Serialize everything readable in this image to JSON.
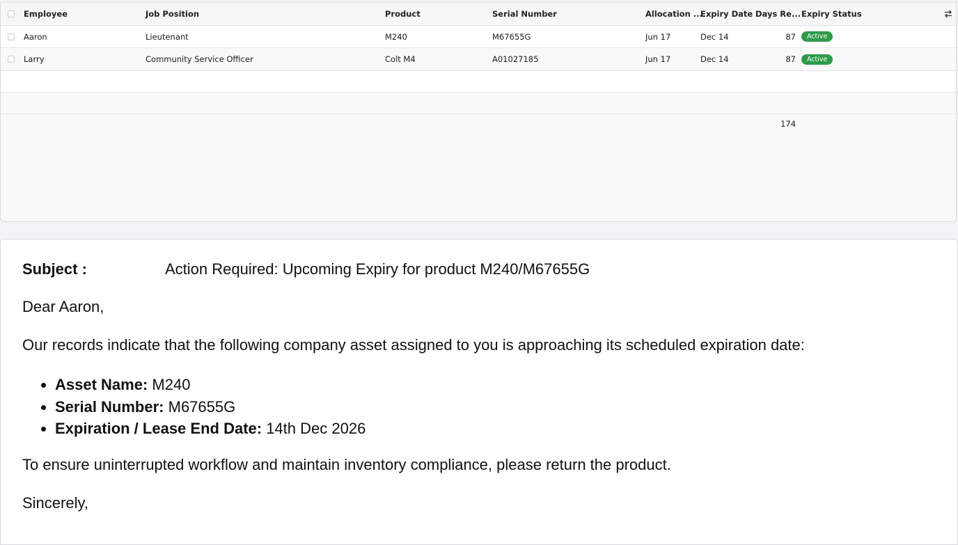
{
  "table": {
    "columns": {
      "employee": "Employee",
      "job_position": "Job Position",
      "product": "Product",
      "serial_number": "Serial Number",
      "allocation": "Allocation ...",
      "expiry_date": "Expiry Date",
      "days_remaining": "Days Re...",
      "expiry_status": "Expiry Status"
    },
    "rows": [
      {
        "employee": "Aaron",
        "job_position": "Lieutenant",
        "product": "M240",
        "serial_number": "M67655G",
        "allocation": "Jun 17",
        "expiry_date": "Dec 14",
        "days_remaining": "87",
        "expiry_status": "Active"
      },
      {
        "employee": "Larry",
        "job_position": "Community Service Officer",
        "product": "Colt M4",
        "serial_number": "A01027185",
        "allocation": "Jun 17",
        "expiry_date": "Dec 14",
        "days_remaining": "87",
        "expiry_status": "Active"
      }
    ],
    "total_days_remaining": "174",
    "status_color": "#2e9b48",
    "column_settings_icon": "swap-arrows-icon"
  },
  "email": {
    "subject_label": "Subject :",
    "subject_text": "Action Required: Upcoming Expiry for product M240/M67655G",
    "greeting": "Dear Aaron,",
    "intro": "Our records indicate that the following company asset assigned to you is approaching its scheduled expiration date:",
    "details": [
      {
        "label": "Asset Name:",
        "value": " M240"
      },
      {
        "label": "Serial Number:",
        "value": " M67655G"
      },
      {
        "label": "Expiration / Lease End Date:",
        "value": " 14th Dec 2026"
      }
    ],
    "closing": "To ensure uninterrupted workflow and maintain inventory compliance, please return the product.",
    "signoff": "Sincerely,"
  }
}
